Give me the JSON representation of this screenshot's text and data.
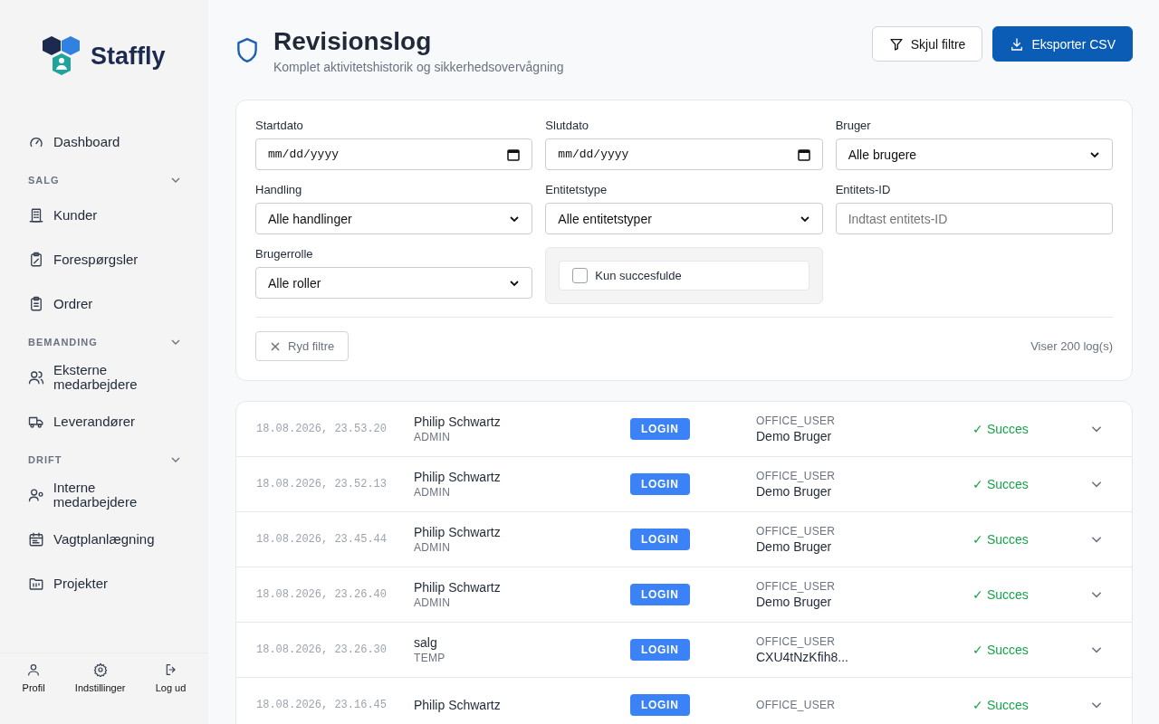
{
  "sidebar": {
    "brand": "Staffly",
    "items": [
      {
        "kind": "link",
        "label": "Dashboard"
      },
      {
        "kind": "section",
        "label": "SALG",
        "expanded": true
      },
      {
        "kind": "link",
        "label": "Kunder"
      },
      {
        "kind": "link",
        "label": "Forespørgsler"
      },
      {
        "kind": "link",
        "label": "Ordrer"
      },
      {
        "kind": "section",
        "label": "BEMANDING",
        "expanded": true
      },
      {
        "kind": "link",
        "label": "Eksterne medarbejdere"
      },
      {
        "kind": "link",
        "label": "Leverandører"
      },
      {
        "kind": "section",
        "label": "DRIFT",
        "expanded": true
      },
      {
        "kind": "link",
        "label": "Interne medarbejdere"
      },
      {
        "kind": "link",
        "label": "Vagtplanlægning"
      },
      {
        "kind": "link",
        "label": "Projekter"
      }
    ],
    "footer": [
      {
        "label": "Profil"
      },
      {
        "label": "Indstillinger"
      },
      {
        "label": "Log ud"
      }
    ]
  },
  "header": {
    "title": "Revisionslog",
    "subtitle": "Komplet aktivitetshistorik og sikkerhedsovervågning",
    "buttons": [
      {
        "label": "Skjul filtre",
        "kind": "secondary"
      },
      {
        "label": "Eksporter CSV",
        "kind": "primary"
      }
    ]
  },
  "filters": {
    "fields": [
      {
        "kind": "date",
        "label": "Startdato",
        "value": "mm/dd/yyyy"
      },
      {
        "kind": "date",
        "label": "Slutdato",
        "value": "mm/dd/yyyy"
      },
      {
        "kind": "select",
        "label": "Bruger",
        "value": "Alle brugere"
      },
      {
        "kind": "select",
        "label": "Handling",
        "value": "Alle handlinger"
      },
      {
        "kind": "select",
        "label": "Entitetstype",
        "value": "Alle entitetstyper"
      },
      {
        "kind": "text",
        "label": "Entitets-ID",
        "placeholder": "Indtast entitets-ID"
      },
      {
        "kind": "select",
        "label": "Brugerrolle",
        "value": "Alle roller"
      },
      {
        "kind": "checkbox",
        "label": "Kun succesfulde",
        "checked": false
      }
    ],
    "clear": "Ryd filtre",
    "count": "Viser 200 log(s)"
  },
  "logs": [
    {
      "time": "18.08.2026, 23.53.20",
      "user": "Philip Schwartz",
      "role": "ADMIN",
      "action": "LOGIN",
      "entity_type": "OFFICE_USER",
      "entity": "Demo Bruger",
      "status": "✓ Succes",
      "success": true
    },
    {
      "time": "18.08.2026, 23.52.13",
      "user": "Philip Schwartz",
      "role": "ADMIN",
      "action": "LOGIN",
      "entity_type": "OFFICE_USER",
      "entity": "Demo Bruger",
      "status": "✓ Succes",
      "success": true
    },
    {
      "time": "18.08.2026, 23.45.44",
      "user": "Philip Schwartz",
      "role": "ADMIN",
      "action": "LOGIN",
      "entity_type": "OFFICE_USER",
      "entity": "Demo Bruger",
      "status": "✓ Succes",
      "success": true
    },
    {
      "time": "18.08.2026, 23.26.40",
      "user": "Philip Schwartz",
      "role": "ADMIN",
      "action": "LOGIN",
      "entity_type": "OFFICE_USER",
      "entity": "Demo Bruger",
      "status": "✓ Succes",
      "success": true
    },
    {
      "time": "18.08.2026, 23.26.30",
      "user": "salg",
      "role": "TEMP",
      "action": "LOGIN",
      "entity_type": "OFFICE_USER",
      "entity": "CXU4tNzKfih8...",
      "status": "✓ Succes",
      "success": true
    },
    {
      "time": "18.08.2026, 23.16.45",
      "user": "Philip Schwartz",
      "action": "LOGIN",
      "entity_type": "OFFICE_USER",
      "status": "✓ Succes",
      "success": true
    }
  ]
}
